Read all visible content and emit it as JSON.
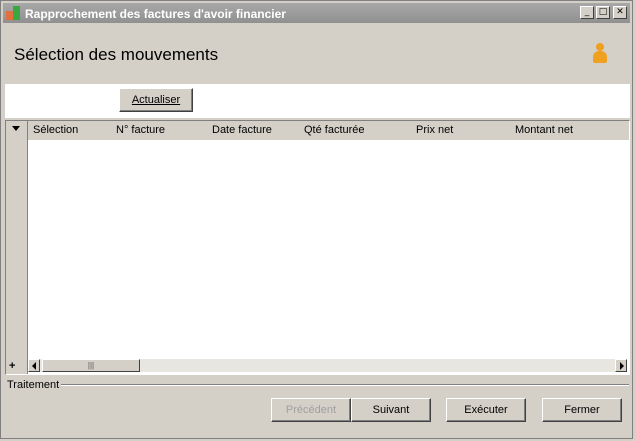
{
  "window": {
    "title": "Rapprochement des factures d'avoir financier",
    "controls": {
      "minimize": "_",
      "maximize": "□",
      "close": "✕"
    }
  },
  "header": {
    "title": "Sélection des mouvements",
    "icon": "person-icon",
    "accent_color": "#f0a020"
  },
  "toolbar": {
    "refresh_label": "Actualiser"
  },
  "grid": {
    "columns": [
      "Sélection",
      "N° facture",
      "Date facture",
      "Qté facturée",
      "Prix net",
      "Montant net"
    ],
    "rows": [],
    "add_symbol": "+",
    "scroll_thumb_grip": "|||"
  },
  "footer": {
    "group_label": "Traitement",
    "buttons": {
      "previous": "Précédent",
      "next": "Suivant",
      "execute": "Exécuter",
      "close": "Fermer"
    }
  }
}
